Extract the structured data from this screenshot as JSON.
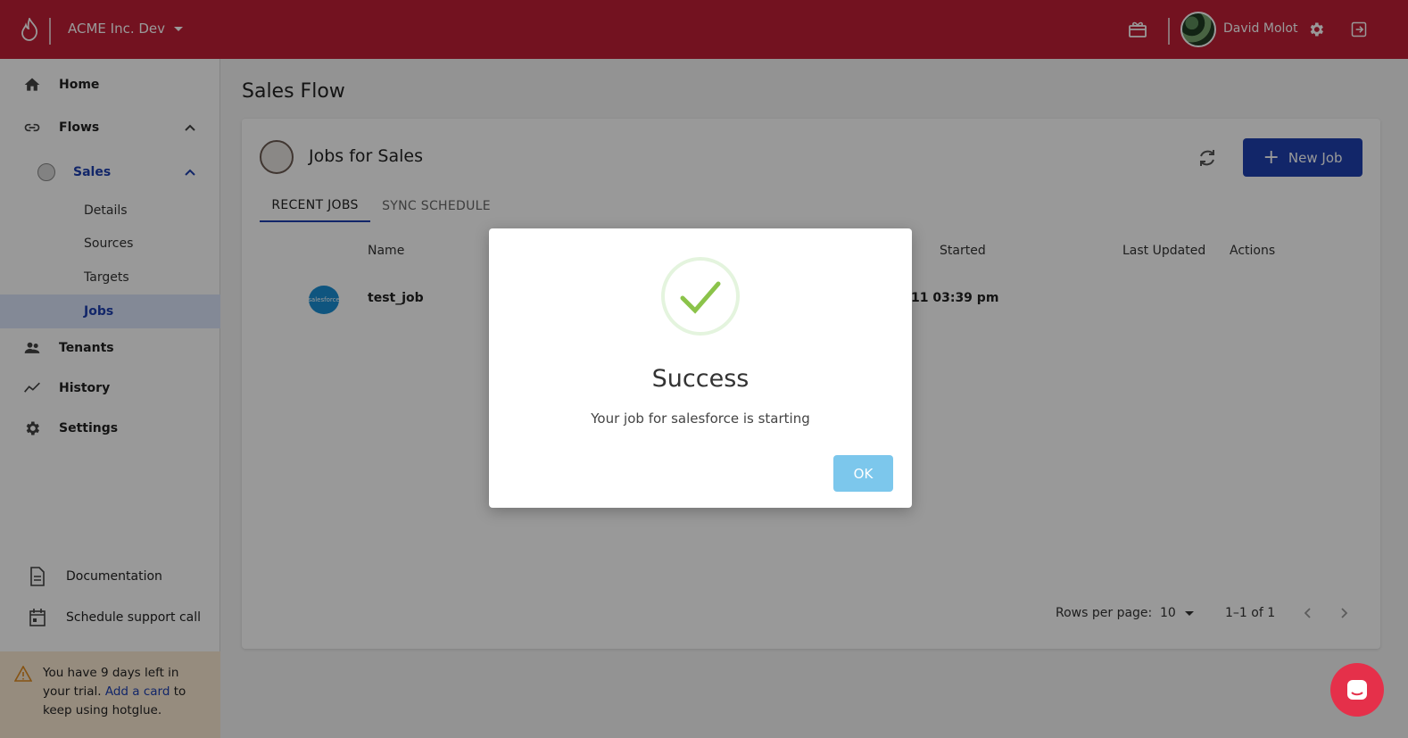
{
  "header": {
    "org_name": "ACME Inc. Dev",
    "user_name": "David Molot"
  },
  "sidebar": {
    "items": [
      {
        "label": "Home",
        "icon": "home-icon"
      },
      {
        "label": "Flows",
        "icon": "link-icon"
      },
      {
        "label": "Tenants",
        "icon": "people-icon"
      },
      {
        "label": "History",
        "icon": "trend-icon"
      },
      {
        "label": "Settings",
        "icon": "gear-icon"
      }
    ],
    "flow": {
      "label": "Sales"
    },
    "sub_items": [
      "Details",
      "Sources",
      "Targets",
      "Jobs"
    ],
    "active_sub": "Jobs",
    "bottom_links": [
      "Documentation",
      "Schedule support call"
    ],
    "trial": {
      "pre": "You have 9 days left in your trial. ",
      "link": "Add a card",
      "post": " to keep using hotglue."
    }
  },
  "main": {
    "page_title": "Sales Flow",
    "card_title": "Jobs for Sales",
    "new_job_label": "New Job",
    "tabs": [
      "RECENT JOBS",
      "SYNC SCHEDULE"
    ],
    "columns": [
      "Name",
      "Started",
      "Last Updated",
      "Actions"
    ],
    "rows": [
      {
        "logo_text": "salesforce",
        "name": "test_job",
        "started": "11 03:39 pm"
      }
    ],
    "pagination": {
      "rows_per_page_label": "Rows per page:",
      "rows_per_page": "10",
      "range": "1–1 of 1"
    }
  },
  "dialog": {
    "title": "Success",
    "message": "Your job for salesforce is starting",
    "ok_label": "OK"
  },
  "colors": {
    "brand": "#c01f36",
    "primary": "#1e40af",
    "success": "#8bc34a",
    "ok_button": "#7cc7ec"
  }
}
